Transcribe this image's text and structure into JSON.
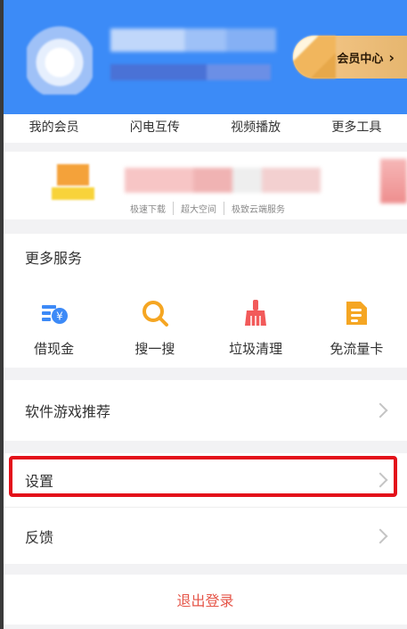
{
  "header": {
    "vip_center_label": "会员中心",
    "vip_center_chevron": "›"
  },
  "tools_row": {
    "items": [
      "我的会员",
      "闪电互传",
      "视频播放",
      "更多工具"
    ]
  },
  "promo": {
    "tags": [
      "极速下载",
      "超大空间",
      "极致云端服务"
    ]
  },
  "services": {
    "title": "更多服务",
    "items": [
      {
        "label": "借现金",
        "icon": "cash-loan-icon",
        "color": "#3d8af7"
      },
      {
        "label": "搜一搜",
        "icon": "search-icon",
        "color": "#f5a623"
      },
      {
        "label": "垃圾清理",
        "icon": "broom-icon",
        "color": "#f25a5a"
      },
      {
        "label": "免流量卡",
        "icon": "sim-card-icon",
        "color": "#f5a623"
      }
    ]
  },
  "menu": {
    "games_label": "软件游戏推荐",
    "settings_label": "设置",
    "feedback_label": "反馈",
    "logout_label": "退出登录"
  },
  "colors": {
    "header_blue": "#3c8bf7",
    "highlight_red": "#e3101a",
    "logout_red": "#e55548"
  }
}
